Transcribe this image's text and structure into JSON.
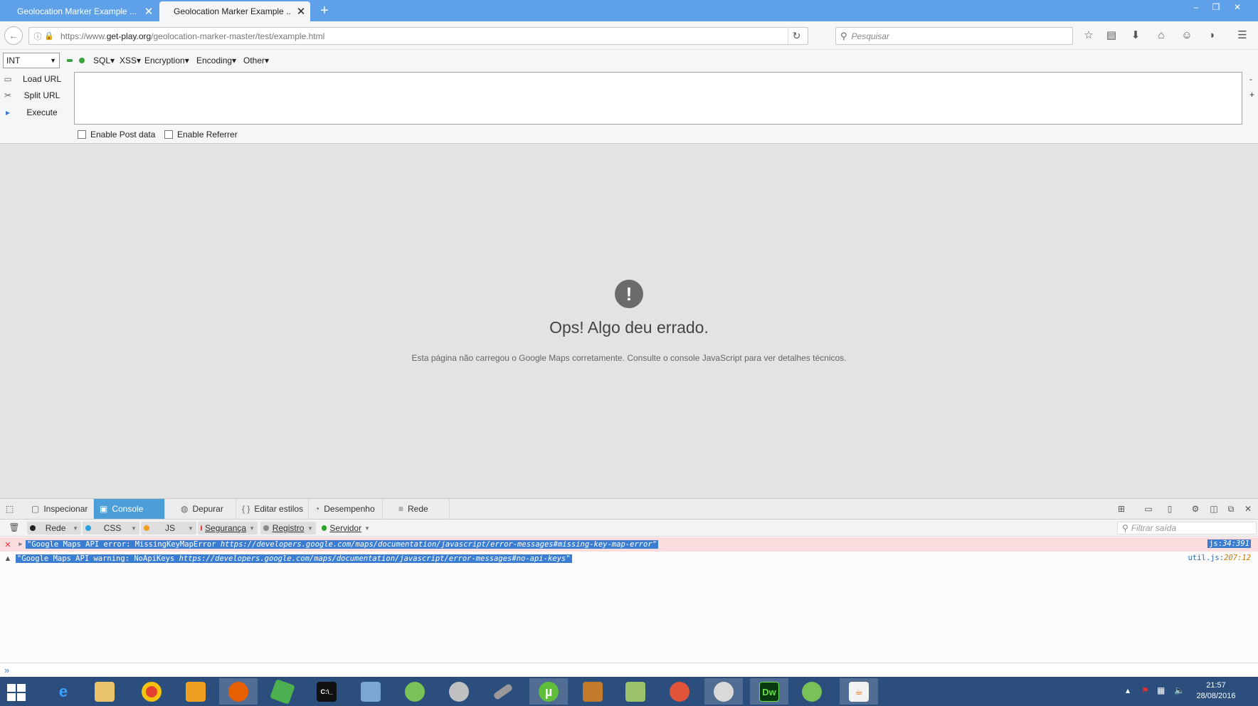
{
  "tabs": [
    {
      "title": "Geolocation Marker Example ...",
      "active": false
    },
    {
      "title": "Geolocation Marker Example ...",
      "active": true
    }
  ],
  "navbar": {
    "url_prefix": "https://www.",
    "url_domain": "get-play.org",
    "url_path": "/geolocation-marker-master/test/example.html",
    "search_placeholder": "Pesquisar"
  },
  "hackbar": {
    "select_value": "INT",
    "menus": [
      "SQL▾",
      "XSS▾",
      "Encryption▾",
      "Encoding▾",
      "Other▾"
    ],
    "buttons": [
      "Load URL",
      "Split URL",
      "Execute"
    ],
    "checkboxes": [
      "Enable Post data",
      "Enable Referrer"
    ]
  },
  "page": {
    "error_title": "Ops! Algo deu errado.",
    "error_description": "Esta página não carregou o Google Maps corretamente. Consulte o console JavaScript para ver detalhes técnicos."
  },
  "devtools": {
    "tabs": [
      "Inspecionar",
      "Console",
      "Depurar",
      "Editar estilos",
      "Desempenho",
      "Rede"
    ],
    "selected_tab": "Console",
    "filters": [
      "Rede",
      "CSS",
      "JS",
      "Segurança",
      "Registro",
      "Servidor"
    ],
    "filter_placeholder": "Filtrar saída",
    "logs": [
      {
        "level": "error",
        "text": "\"Google Maps API error: MissingKeyMapError ",
        "link": "https://developers.google.com/maps/documentation/javascript/error-messages#missing-key-map-error",
        "end": "\"",
        "source_file": "js:",
        "source_line": "34:391"
      },
      {
        "level": "warning",
        "text": "\"Google Maps API warning: NoApiKeys ",
        "link": "https://developers.google.com/maps/documentation/javascript/error-messages#no-api-keys",
        "end": "\"",
        "source_file": "util.js:",
        "source_line": "207:12"
      }
    ],
    "prompt": "»"
  },
  "taskbar": {
    "time": "21:57",
    "date": "28/08/2016"
  },
  "colors": {
    "tabbar": "#5fa1e8",
    "selected_tab": "#4c9ed9",
    "error_row": "#fbdde0",
    "selection": "#3b7dd1",
    "taskbar": "#2b4e7c"
  }
}
